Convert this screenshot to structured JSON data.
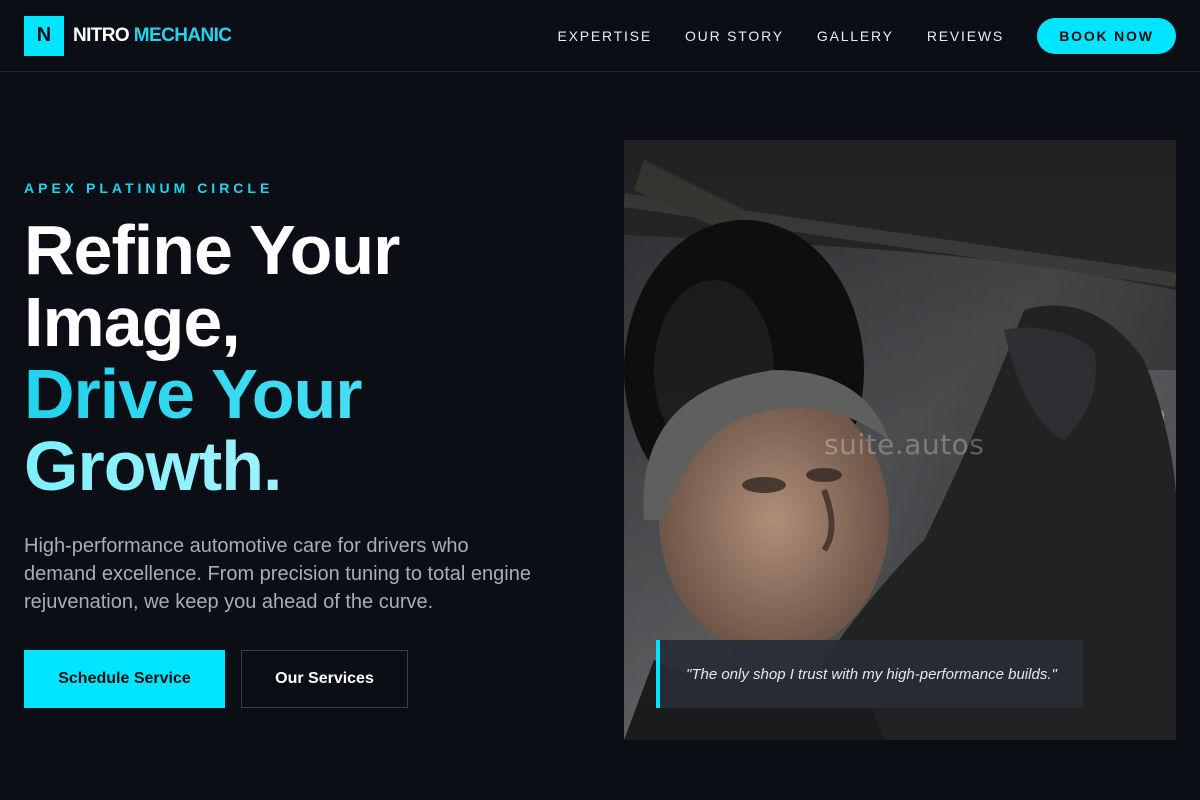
{
  "brand": {
    "mark": "N",
    "name_primary": "NITRO",
    "name_accent": "MECHANIC"
  },
  "nav": {
    "links": [
      {
        "label": "EXPERTISE"
      },
      {
        "label": "OUR STORY"
      },
      {
        "label": "GALLERY"
      },
      {
        "label": "REVIEWS"
      }
    ],
    "cta_label": "BOOK NOW"
  },
  "hero": {
    "eyebrow": "APEX PLATINUM CIRCLE",
    "headline": {
      "line1": "Refine Your",
      "line2": "Image,",
      "line3": "Drive Your",
      "line4": "Growth."
    },
    "subtext": "High-performance automotive care for drivers who demand excellence. From precision tuning to total engine rejuvenation, we keep you ahead of the curve.",
    "primary_cta": "Schedule Service",
    "secondary_cta": "Our Services"
  },
  "photo": {
    "watermark": "suite.autos",
    "quote": "\"The only shop I trust with my high-performance builds.\""
  },
  "colors": {
    "background": "#0b0e15",
    "accent": "#00e5ff",
    "accent_text": "#22d3ee",
    "muted_text": "#a7adb9"
  }
}
